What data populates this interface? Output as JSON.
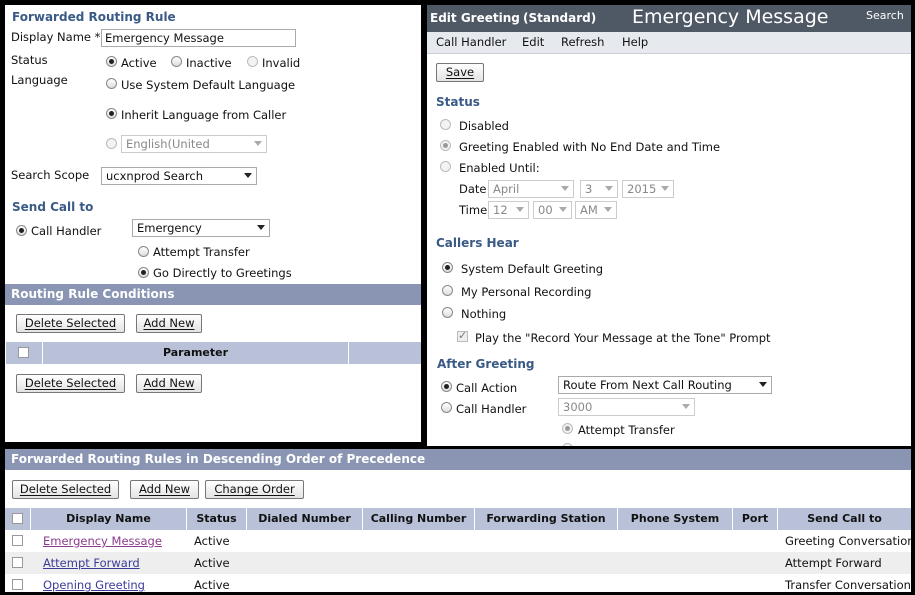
{
  "left": {
    "title": "Forwarded Routing Rule",
    "display_name_label": "Display Name",
    "display_name_value": "Emergency Message",
    "status_label": "Status",
    "status_options": [
      "Active",
      "Inactive",
      "Invalid"
    ],
    "language_label": "Language",
    "language_options": [
      "Use System Default Language",
      "Inherit Language from Caller"
    ],
    "language_select": "English(United States)",
    "search_scope_label": "Search Scope",
    "search_scope_value": "ucxnprod Search Space",
    "send_call_title": "Send Call to",
    "call_handler_label": "Call Handler",
    "call_handler_value": "Emergency Message",
    "transfer_options": [
      "Attempt Transfer",
      "Go Directly to Greetings"
    ],
    "conditions_title": "Routing Rule Conditions",
    "delete_selected": "Delete Selected",
    "add_new": "Add New",
    "parameter_header": "Parameter"
  },
  "right": {
    "header_title": "Edit Greeting",
    "header_subtitle": "(Standard)",
    "header_big": "Emergency Message",
    "search_link": "Search",
    "menu": [
      "Call Handler",
      "Edit",
      "Refresh",
      "Help"
    ],
    "save": "Save",
    "status_title": "Status",
    "status_options": [
      "Disabled",
      "Greeting Enabled with No End Date and Time",
      "Enabled Until:"
    ],
    "date_label": "Date",
    "date_month": "April",
    "date_day": "3",
    "date_year": "2015",
    "time_label": "Time",
    "time_hour": "12",
    "time_min": "00",
    "time_ampm": "AM",
    "callers_hear_title": "Callers Hear",
    "callers_hear_options": [
      "System Default Greeting",
      "My Personal Recording",
      "Nothing"
    ],
    "record_prompt": "Play the \"Record Your Message at the Tone\" Prompt",
    "after_greeting_title": "After Greeting",
    "call_action_label": "Call Action",
    "call_action_value": "Route From Next Call Routing Rule",
    "call_handler_label": "Call Handler",
    "call_handler_value": "3000",
    "attempt_transfer": "Attempt Transfer"
  },
  "bottom": {
    "title": "Forwarded Routing Rules in Descending Order of Precedence",
    "delete_selected": "Delete Selected",
    "add_new": "Add New",
    "change_order": "Change Order",
    "columns": [
      "Display Name",
      "Status",
      "Dialed Number",
      "Calling Number",
      "Forwarding Station",
      "Phone System",
      "Port",
      "Send Call to"
    ],
    "rows": [
      {
        "name": "Emergency Message",
        "status": "Active",
        "send_to": "Greeting Conversation"
      },
      {
        "name": "Attempt Forward",
        "status": "Active",
        "send_to": "Attempt Forward"
      },
      {
        "name": "Opening Greeting",
        "status": "Active",
        "send_to": "Transfer Conversation"
      }
    ]
  },
  "colors": {
    "section_bar": "#8995b2",
    "table_header": "#b9c1d8",
    "section_title": "#3a5a86",
    "link": "#3b3c9a",
    "visited_link": "#8c3a8c",
    "right_header": "#4f5865"
  }
}
